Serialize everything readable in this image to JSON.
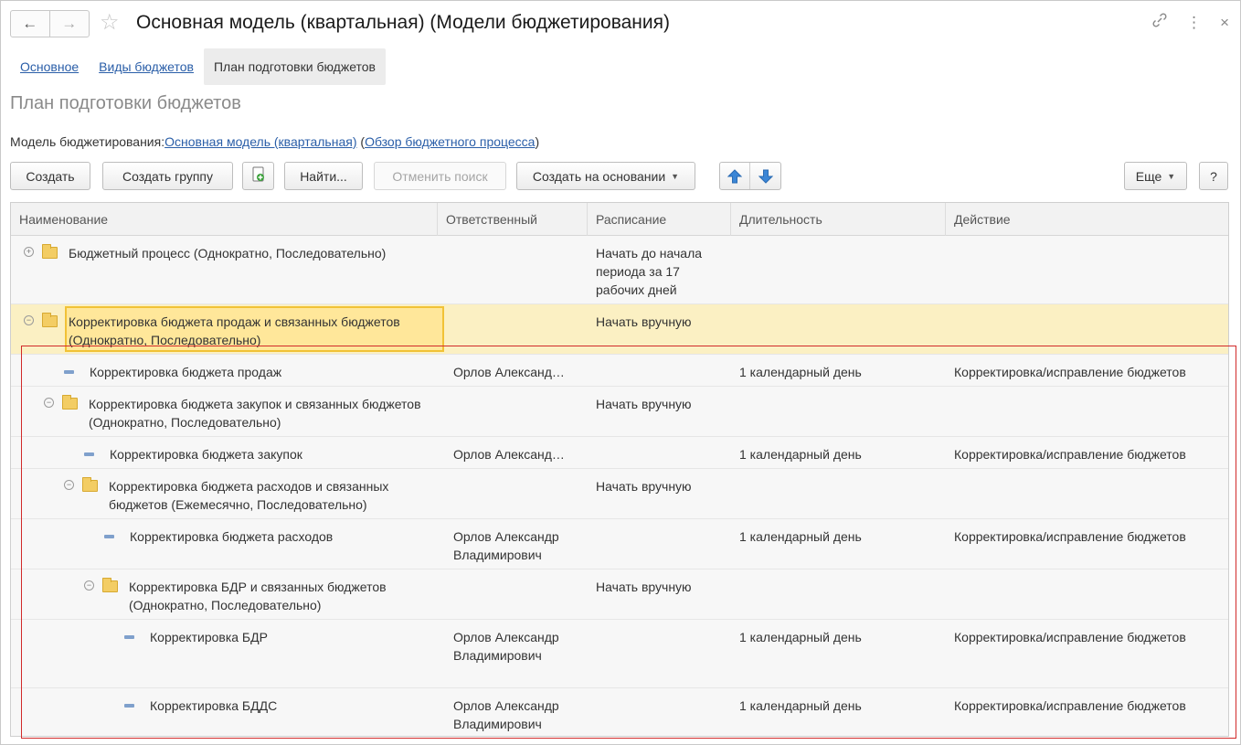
{
  "window": {
    "title": "Основная модель (квартальная) (Модели бюджетирования)",
    "back_glyph": "←",
    "forward_glyph": "→",
    "star_glyph": "☆",
    "link_glyph": "🔗",
    "more_glyph": "⋮",
    "close_glyph": "×"
  },
  "tabs": [
    {
      "label": "Основное"
    },
    {
      "label": "Виды бюджетов"
    },
    {
      "label": "План подготовки бюджетов"
    }
  ],
  "page_title": "План подготовки бюджетов",
  "model_line": {
    "label": "Модель бюджетирования:",
    "model_link": "Основная модель (квартальная)",
    "open_paren": " (",
    "overview_link": "Обзор бюджетного процесса",
    "close_paren": ")"
  },
  "toolbar": {
    "create": "Создать",
    "create_group": "Создать группу",
    "find": "Найти...",
    "cancel_search": "Отменить поиск",
    "create_based": "Создать на основании",
    "more": "Еще",
    "help": "?"
  },
  "table": {
    "columns": [
      "Наименование",
      "Ответственный",
      "Расписание",
      "Длительность",
      "Действие"
    ],
    "rows": [
      {
        "name": "Бюджетный процесс (Однократно, Последовательно)",
        "responsible": "",
        "schedule": "Начать до начала периода за 17 рабочих дней",
        "duration": "",
        "action": ""
      },
      {
        "name": "Корректировка бюджета продаж и связанных бюджетов (Однократно, Последовательно)",
        "responsible": "",
        "schedule": "Начать вручную",
        "duration": "",
        "action": ""
      },
      {
        "name": "Корректировка бюджета продаж",
        "responsible": "Орлов Александ…",
        "schedule": "",
        "duration": "1 календарный день",
        "action": "Корректировка/исправление бюджетов"
      },
      {
        "name": "Корректировка бюджета закупок и связанных бюджетов (Однократно, Последовательно)",
        "responsible": "",
        "schedule": "Начать вручную",
        "duration": "",
        "action": ""
      },
      {
        "name": "Корректировка бюджета закупок",
        "responsible": "Орлов Александ…",
        "schedule": "",
        "duration": "1 календарный день",
        "action": "Корректировка/исправление бюджетов"
      },
      {
        "name": "Корректировка бюджета расходов и связанных бюджетов (Ежемесячно, Последовательно)",
        "responsible": "",
        "schedule": "Начать вручную",
        "duration": "",
        "action": ""
      },
      {
        "name": "Корректировка бюджета расходов",
        "responsible": "Орлов Александр Владимирович",
        "schedule": "",
        "duration": "1 календарный день",
        "action": "Корректировка/исправление бюджетов"
      },
      {
        "name": "Корректировка БДР и связанных бюджетов (Однократно, Последовательно)",
        "responsible": "",
        "schedule": "Начать вручную",
        "duration": "",
        "action": ""
      },
      {
        "name": "Корректировка БДР",
        "responsible": "Орлов Александр Владимирович",
        "schedule": "",
        "duration": "1 календарный день",
        "action": "Корректировка/исправление бюджетов"
      },
      {
        "name": "Корректировка БДДС",
        "responsible": "Орлов Александр Владимирович",
        "schedule": "",
        "duration": "1 календарный день",
        "action": "Корректировка/исправление бюджетов"
      }
    ]
  },
  "colors": {
    "accent_link": "#2a5ea8",
    "selected_row": "#fbf0c3",
    "highlight_frame": "#d12a2a",
    "folder": "#f3cd64"
  }
}
